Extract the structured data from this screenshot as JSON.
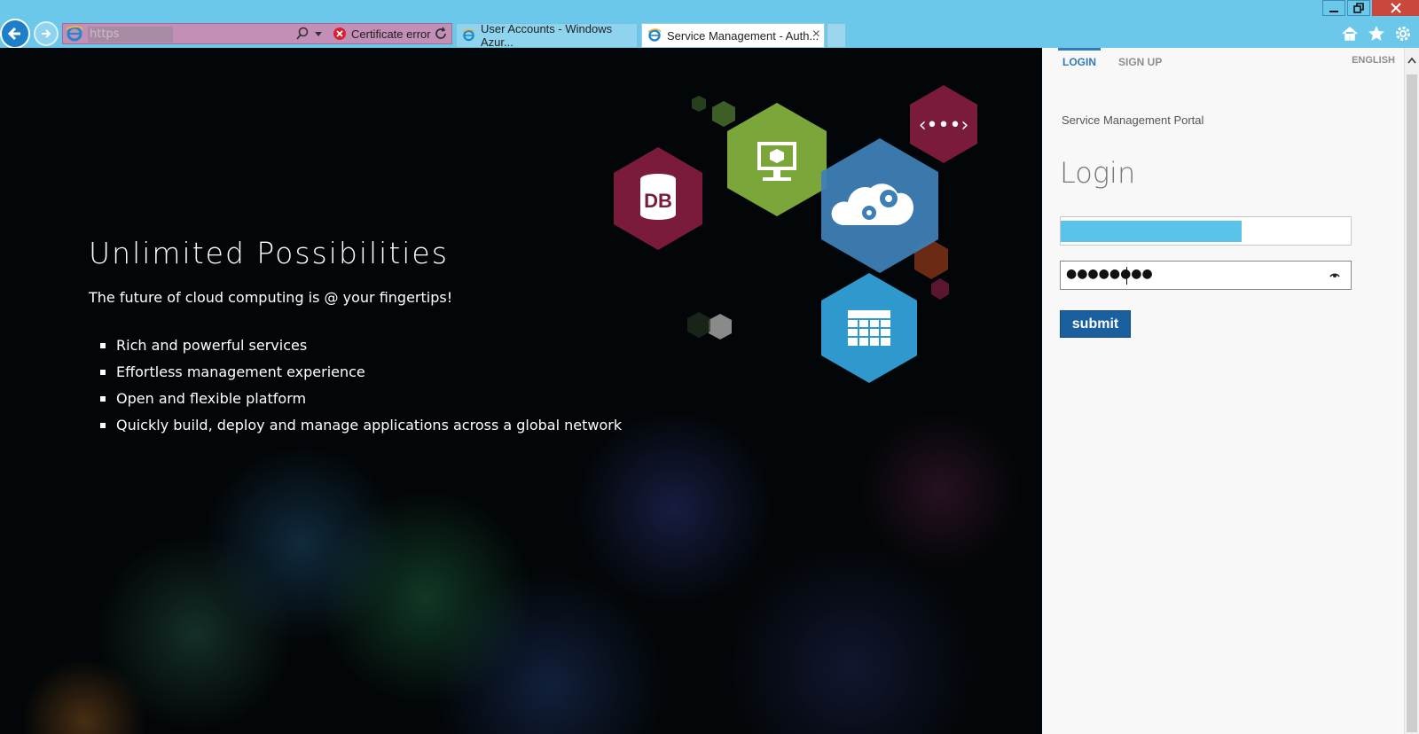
{
  "browser": {
    "address_text": "https",
    "certificate_error": "Certificate error",
    "tabs": [
      {
        "label": "User Accounts - Windows Azur..."
      },
      {
        "label": "Service Management - Auth..."
      }
    ]
  },
  "hero": {
    "title": "Unlimited Possibilities",
    "subtitle": "The future of cloud computing is @ your fingertips!",
    "features": [
      "Rich and powerful services",
      "Effortless management experience",
      "Open and flexible platform",
      "Quickly build, deploy and manage applications across a global network"
    ],
    "icons": [
      "database-icon",
      "monitor-icon",
      "cloud-gears-icon",
      "network-icon",
      "table-icon"
    ]
  },
  "panel": {
    "tabs": [
      {
        "label": "LOGIN"
      },
      {
        "label": "SIGN UP"
      }
    ],
    "language": "ENGLISH",
    "portal_name": "Service Management Portal",
    "login_title": "Login",
    "password_mask": "●●●●●●●●",
    "submit_label": "submit"
  },
  "colors": {
    "chrome": "#6bc8ea",
    "accent": "#2d7cbc",
    "submit": "#1a5f9e",
    "hex_db": "#7a1b3c",
    "hex_monitor": "#7aa63a",
    "hex_cloud": "#3e7fb6",
    "hex_table": "#2f98cc"
  }
}
